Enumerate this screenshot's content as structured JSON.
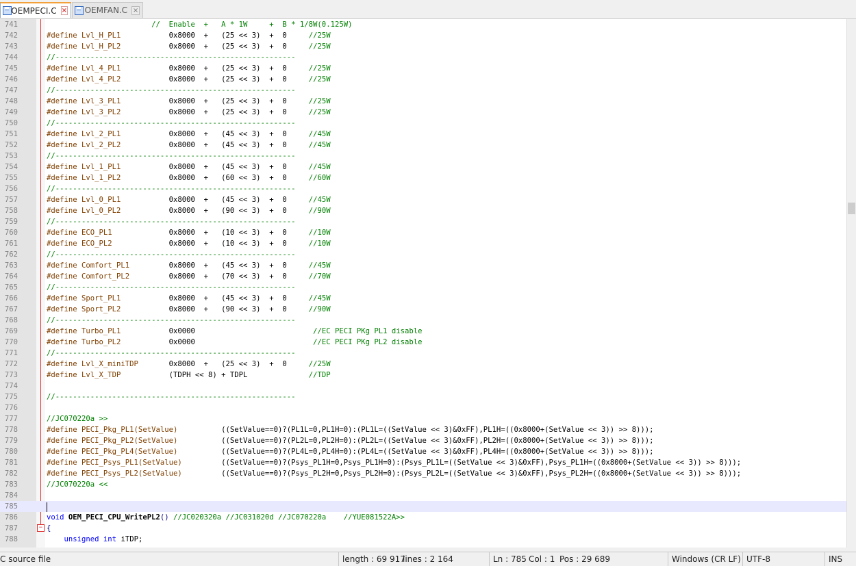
{
  "tabs": [
    {
      "name": "OEMPECI.C",
      "active": true
    },
    {
      "name": "OEMFAN.C",
      "active": false
    }
  ],
  "editor": {
    "current_line": 785,
    "lines": [
      {
        "n": "741",
        "segs": [
          [
            "cm",
            "                        //  Enable  +   A * 1W     +  B * 1/8W(0.125W)"
          ]
        ]
      },
      {
        "n": "742",
        "segs": [
          [
            "pp",
            "#define Lvl_H_PL1"
          ],
          [
            "",
            "           0x8000  +   (25 << 3)  +  0     "
          ],
          [
            "cm",
            "//25W"
          ]
        ]
      },
      {
        "n": "743",
        "segs": [
          [
            "pp",
            "#define Lvl_H_PL2"
          ],
          [
            "",
            "           0x8000  +   (25 << 3)  +  0     "
          ],
          [
            "cm",
            "//25W"
          ]
        ]
      },
      {
        "n": "744",
        "segs": [
          [
            "cm",
            "//-------------------------------------------------------"
          ]
        ]
      },
      {
        "n": "745",
        "segs": [
          [
            "pp",
            "#define Lvl_4_PL1"
          ],
          [
            "",
            "           0x8000  +   (25 << 3)  +  0     "
          ],
          [
            "cm",
            "//25W"
          ]
        ]
      },
      {
        "n": "746",
        "segs": [
          [
            "pp",
            "#define Lvl_4_PL2"
          ],
          [
            "",
            "           0x8000  +   (25 << 3)  +  0     "
          ],
          [
            "cm",
            "//25W"
          ]
        ]
      },
      {
        "n": "747",
        "segs": [
          [
            "cm",
            "//-------------------------------------------------------"
          ]
        ]
      },
      {
        "n": "748",
        "segs": [
          [
            "pp",
            "#define Lvl_3_PL1"
          ],
          [
            "",
            "           0x8000  +   (25 << 3)  +  0     "
          ],
          [
            "cm",
            "//25W"
          ]
        ]
      },
      {
        "n": "749",
        "segs": [
          [
            "pp",
            "#define Lvl_3_PL2"
          ],
          [
            "",
            "           0x8000  +   (25 << 3)  +  0     "
          ],
          [
            "cm",
            "//25W"
          ]
        ]
      },
      {
        "n": "750",
        "segs": [
          [
            "cm",
            "//-------------------------------------------------------"
          ]
        ]
      },
      {
        "n": "751",
        "segs": [
          [
            "pp",
            "#define Lvl_2_PL1"
          ],
          [
            "",
            "           0x8000  +   (45 << 3)  +  0     "
          ],
          [
            "cm",
            "//45W"
          ]
        ]
      },
      {
        "n": "752",
        "segs": [
          [
            "pp",
            "#define Lvl_2_PL2"
          ],
          [
            "",
            "           0x8000  +   (45 << 3)  +  0     "
          ],
          [
            "cm",
            "//45W"
          ]
        ]
      },
      {
        "n": "753",
        "segs": [
          [
            "cm",
            "//-------------------------------------------------------"
          ]
        ]
      },
      {
        "n": "754",
        "segs": [
          [
            "pp",
            "#define Lvl_1_PL1"
          ],
          [
            "",
            "           0x8000  +   (45 << 3)  +  0     "
          ],
          [
            "cm",
            "//45W"
          ]
        ]
      },
      {
        "n": "755",
        "segs": [
          [
            "pp",
            "#define Lvl_1_PL2"
          ],
          [
            "",
            "           0x8000  +   (60 << 3)  +  0     "
          ],
          [
            "cm",
            "//60W"
          ]
        ]
      },
      {
        "n": "756",
        "segs": [
          [
            "cm",
            "//-------------------------------------------------------"
          ]
        ]
      },
      {
        "n": "757",
        "segs": [
          [
            "pp",
            "#define Lvl_0_PL1"
          ],
          [
            "",
            "           0x8000  +   (45 << 3)  +  0     "
          ],
          [
            "cm",
            "//45W"
          ]
        ]
      },
      {
        "n": "758",
        "segs": [
          [
            "pp",
            "#define Lvl_0_PL2"
          ],
          [
            "",
            "           0x8000  +   (90 << 3)  +  0     "
          ],
          [
            "cm",
            "//90W"
          ]
        ]
      },
      {
        "n": "759",
        "segs": [
          [
            "cm",
            "//-------------------------------------------------------"
          ]
        ]
      },
      {
        "n": "760",
        "segs": [
          [
            "pp",
            "#define ECO_PL1"
          ],
          [
            "",
            "             0x8000  +   (10 << 3)  +  0     "
          ],
          [
            "cm",
            "//10W"
          ]
        ]
      },
      {
        "n": "761",
        "segs": [
          [
            "pp",
            "#define ECO_PL2"
          ],
          [
            "",
            "             0x8000  +   (10 << 3)  +  0     "
          ],
          [
            "cm",
            "//10W"
          ]
        ]
      },
      {
        "n": "762",
        "segs": [
          [
            "cm",
            "//-------------------------------------------------------"
          ]
        ]
      },
      {
        "n": "763",
        "segs": [
          [
            "pp",
            "#define Comfort_PL1"
          ],
          [
            "",
            "         0x8000  +   (45 << 3)  +  0     "
          ],
          [
            "cm",
            "//45W"
          ]
        ]
      },
      {
        "n": "764",
        "segs": [
          [
            "pp",
            "#define Comfort_PL2"
          ],
          [
            "",
            "         0x8000  +   (70 << 3)  +  0     "
          ],
          [
            "cm",
            "//70W"
          ]
        ]
      },
      {
        "n": "765",
        "segs": [
          [
            "cm",
            "//-------------------------------------------------------"
          ]
        ]
      },
      {
        "n": "766",
        "segs": [
          [
            "pp",
            "#define Sport_PL1"
          ],
          [
            "",
            "           0x8000  +   (45 << 3)  +  0     "
          ],
          [
            "cm",
            "//45W"
          ]
        ]
      },
      {
        "n": "767",
        "segs": [
          [
            "pp",
            "#define Sport_PL2"
          ],
          [
            "",
            "           0x8000  +   (90 << 3)  +  0     "
          ],
          [
            "cm",
            "//90W"
          ]
        ]
      },
      {
        "n": "768",
        "segs": [
          [
            "cm",
            "//-------------------------------------------------------"
          ]
        ]
      },
      {
        "n": "769",
        "segs": [
          [
            "pp",
            "#define Turbo_PL1"
          ],
          [
            "",
            "           0x0000                           "
          ],
          [
            "cm",
            "//EC PECI PKg PL1 disable"
          ]
        ]
      },
      {
        "n": "770",
        "segs": [
          [
            "pp",
            "#define Turbo_PL2"
          ],
          [
            "",
            "           0x0000                           "
          ],
          [
            "cm",
            "//EC PECI PKg PL2 disable"
          ]
        ]
      },
      {
        "n": "771",
        "segs": [
          [
            "cm",
            "//-------------------------------------------------------"
          ]
        ]
      },
      {
        "n": "772",
        "segs": [
          [
            "pp",
            "#define Lvl_X_miniTDP"
          ],
          [
            "",
            "       0x8000  +   (25 << 3)  +  0     "
          ],
          [
            "cm",
            "//25W"
          ]
        ]
      },
      {
        "n": "773",
        "segs": [
          [
            "pp",
            "#define Lvl_X_TDP"
          ],
          [
            "",
            "           (TDPH << 8) + TDPL              "
          ],
          [
            "cm",
            "//TDP"
          ]
        ]
      },
      {
        "n": "774",
        "segs": []
      },
      {
        "n": "775",
        "segs": [
          [
            "cm",
            "//-------------------------------------------------------"
          ]
        ]
      },
      {
        "n": "776",
        "segs": []
      },
      {
        "n": "777",
        "segs": [
          [
            "cm",
            "//JC070220a >>"
          ]
        ]
      },
      {
        "n": "778",
        "segs": [
          [
            "pp",
            "#define PECI_Pkg_PL1(SetValue)"
          ],
          [
            "",
            "          ((SetValue==0)?(PL1L=0,PL1H=0):(PL1L=((SetValue << 3)&0xFF),PL1H=((0x8000+(SetValue << 3)) >> 8)));"
          ]
        ]
      },
      {
        "n": "779",
        "segs": [
          [
            "pp",
            "#define PECI_Pkg_PL2(SetValue)"
          ],
          [
            "",
            "          ((SetValue==0)?(PL2L=0,PL2H=0):(PL2L=((SetValue << 3)&0xFF),PL2H=((0x8000+(SetValue << 3)) >> 8)));"
          ]
        ]
      },
      {
        "n": "780",
        "segs": [
          [
            "pp",
            "#define PECI_Pkg_PL4(SetValue)"
          ],
          [
            "",
            "          ((SetValue==0)?(PL4L=0,PL4H=0):(PL4L=((SetValue << 3)&0xFF),PL4H=((0x8000+(SetValue << 3)) >> 8)));"
          ]
        ]
      },
      {
        "n": "781",
        "segs": [
          [
            "pp",
            "#define PECI_Psys_PL1(SetValue)"
          ],
          [
            "",
            "         ((SetValue==0)?(Psys_PL1H=0,Psys_PL1H=0):(Psys_PL1L=((SetValue << 3)&0xFF),Psys_PL1H=((0x8000+(SetValue << 3)) >> 8)));"
          ]
        ]
      },
      {
        "n": "782",
        "segs": [
          [
            "pp",
            "#define PECI_Psys_PL2(SetValue)"
          ],
          [
            "",
            "         ((SetValue==0)?(Psys_PL2H=0,Psys_PL2H=0):(Psys_PL2L=((SetValue << 3)&0xFF),Psys_PL2H=((0x8000+(SetValue << 3)) >> 8)));"
          ]
        ]
      },
      {
        "n": "783",
        "segs": [
          [
            "cm",
            "//JC070220a <<"
          ]
        ]
      },
      {
        "n": "784",
        "segs": []
      },
      {
        "n": "785",
        "segs": []
      },
      {
        "n": "786",
        "segs": [
          [
            "kw",
            "void"
          ],
          [
            "",
            " "
          ],
          [
            "fn",
            "OEM_PECI_CPU_WritePL2"
          ],
          [
            "op",
            "()"
          ],
          [
            "",
            " "
          ],
          [
            "cm",
            "//JC020320a //JC031020d //JC070220a    //YUE081522A>>"
          ]
        ]
      },
      {
        "n": "787",
        "segs": [
          [
            "op",
            "{"
          ]
        ],
        "fold": true
      },
      {
        "n": "788",
        "segs": [
          [
            "",
            "    "
          ],
          [
            "kw",
            "unsigned int"
          ],
          [
            "",
            " iTDP;"
          ]
        ]
      }
    ]
  },
  "status": {
    "filetype": "C source file",
    "length": "length : 69 917",
    "lines": "lines : 2 164",
    "ln": "Ln : 785",
    "col": "Col : 1",
    "pos": "Pos : 29 689",
    "eol": "Windows (CR LF)",
    "encoding": "UTF-8",
    "mode": "INS"
  }
}
